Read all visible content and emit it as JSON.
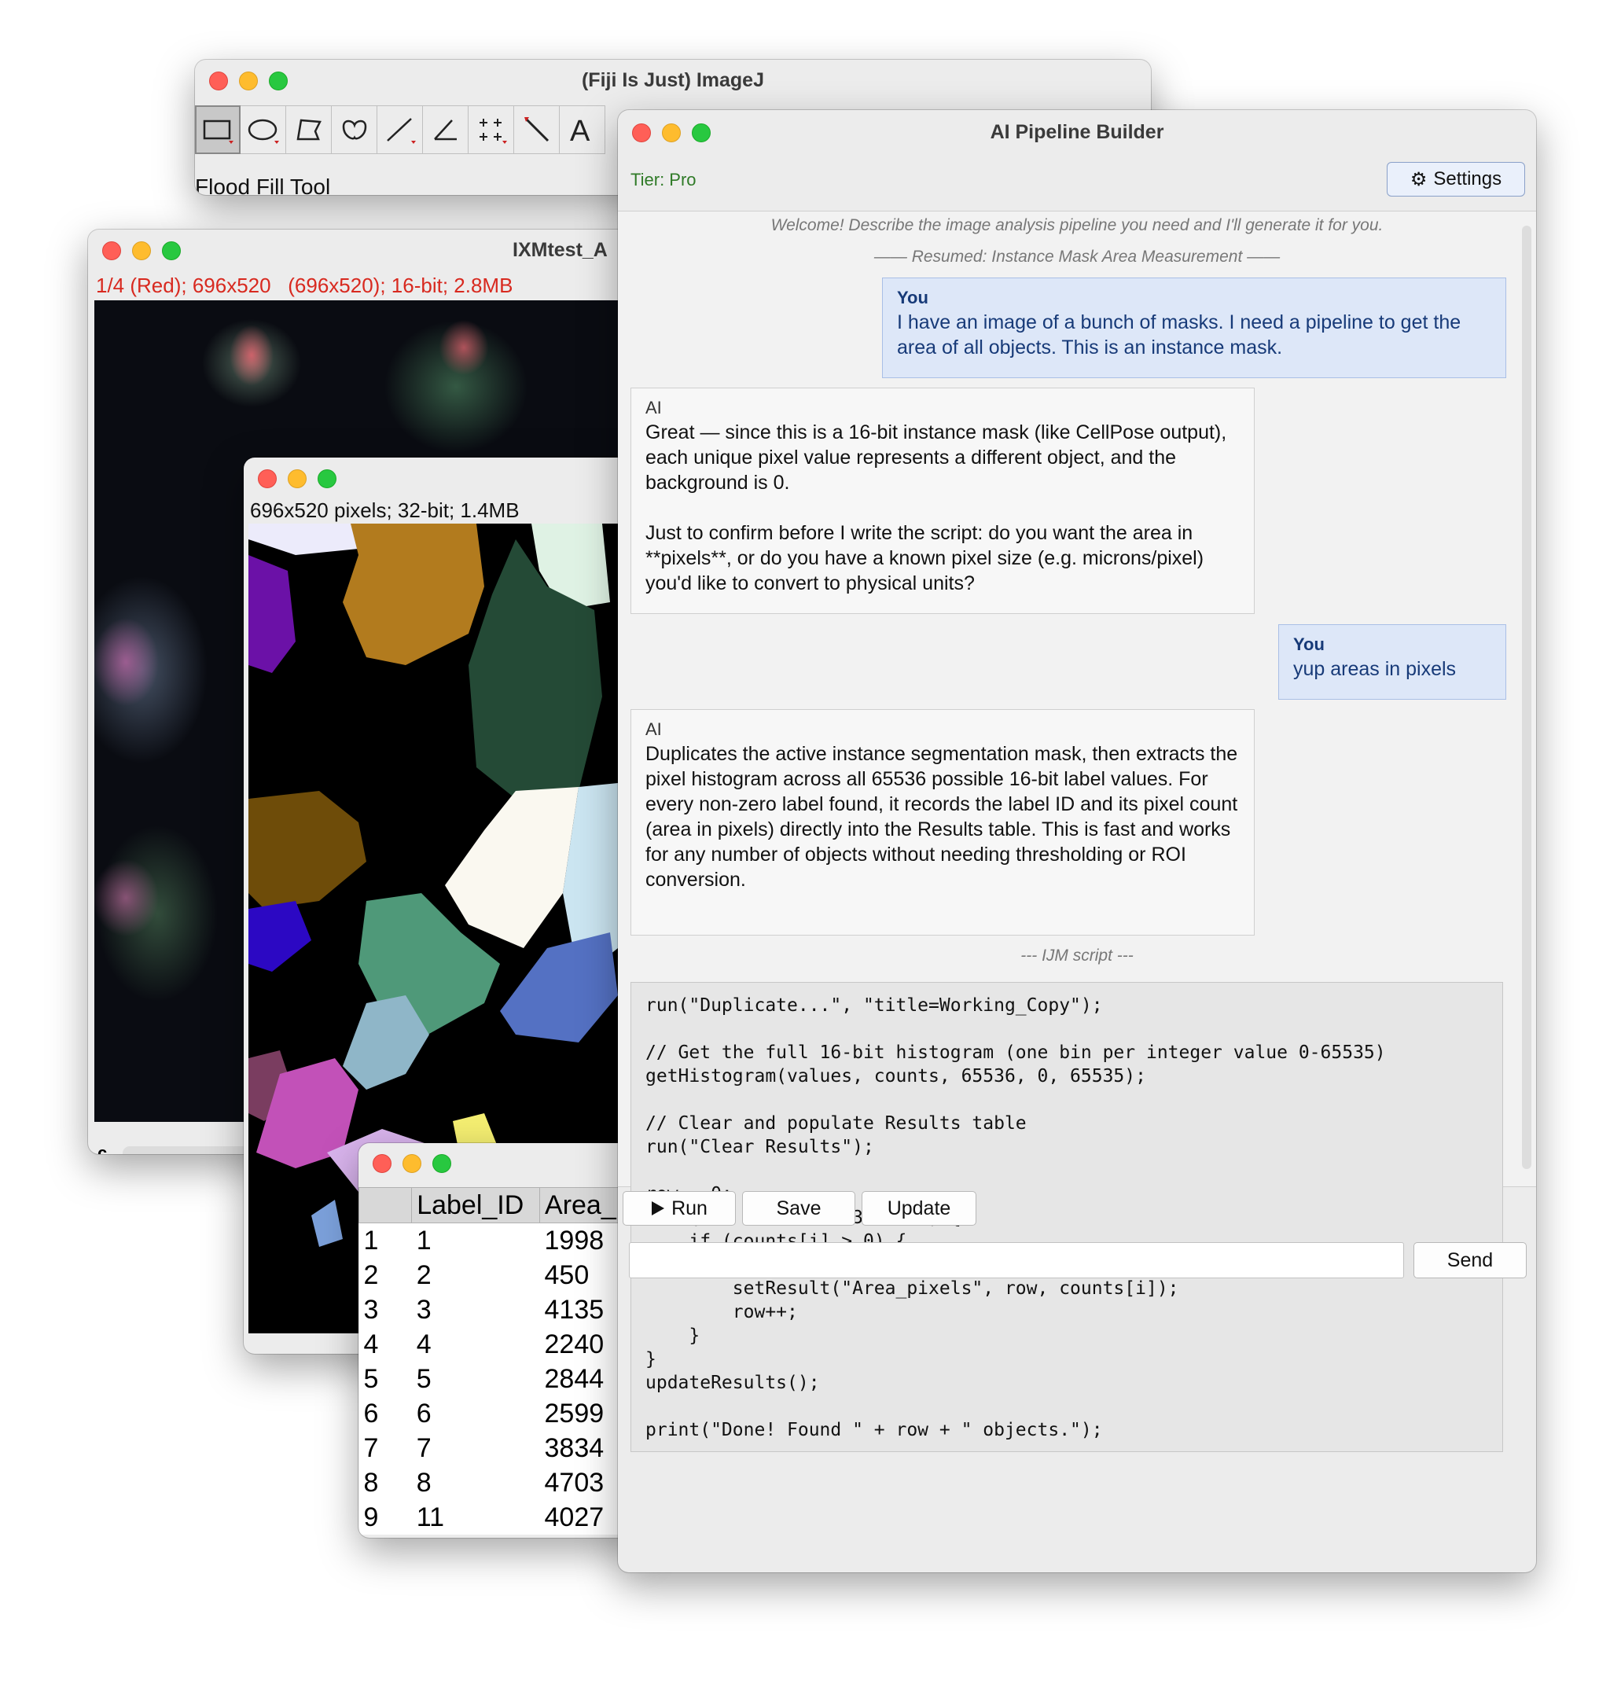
{
  "imagej": {
    "title": "(Fiji Is Just) ImageJ",
    "status": "Flood Fill Tool",
    "tools": [
      "rectangle-icon",
      "oval-icon",
      "polygon-icon",
      "freehand-icon",
      "line-icon",
      "angle-icon",
      "multipoint-icon",
      "wand-icon",
      "text-icon"
    ]
  },
  "ixm": {
    "title": "IXMtest_A",
    "info": "1/4 (Red); 696x520   (696x520); 16-bit; 2.8MB",
    "channel_label": "c"
  },
  "mask_window": {
    "info": "696x520 pixels; 32-bit; 1.4MB"
  },
  "results": {
    "columns": [
      "",
      "Label_ID",
      "Area_"
    ],
    "rows": [
      [
        "1",
        "1",
        "1998"
      ],
      [
        "2",
        "2",
        "450"
      ],
      [
        "3",
        "3",
        "4135"
      ],
      [
        "4",
        "4",
        "2240"
      ],
      [
        "5",
        "5",
        "2844"
      ],
      [
        "6",
        "6",
        "2599"
      ],
      [
        "7",
        "7",
        "3834"
      ],
      [
        "8",
        "8",
        "4703"
      ],
      [
        "9",
        "11",
        "4027"
      ]
    ]
  },
  "ai": {
    "title": "AI Pipeline Builder",
    "tier": "Tier: Pro",
    "settings_label": "Settings",
    "welcome": "Welcome! Describe the image analysis pipeline you need and I'll generate it for you.",
    "resumed": "—— Resumed: Instance Mask Area Measurement ——",
    "messages": [
      {
        "who": "You",
        "text": "I have an image of a bunch of masks. I need a pipeline to get the area of all objects. This is an instance mask."
      },
      {
        "who": "AI",
        "text": "Great — since this is a 16-bit instance mask (like CellPose output), each unique pixel value represents a different object, and the background is 0.\n\nJust to confirm before I write the script: do you want the area in **pixels**, or do you have a known pixel size (e.g. microns/pixel) you'd like to convert to physical units?"
      },
      {
        "who": "You",
        "text": "yup areas in pixels"
      },
      {
        "who": "AI",
        "text": "Duplicates the active instance segmentation mask, then extracts the pixel histogram across all 65536 possible 16-bit label values. For every non-zero label found, it records the label ID and its pixel count (area in pixels) directly into the Results table. This is fast and works for any number of objects without needing thresholding or ROI conversion."
      }
    ],
    "script_label": "--- IJM script ---",
    "script": "run(\"Duplicate...\", \"title=Working_Copy\");\n\n// Get the full 16-bit histogram (one bin per integer value 0-65535)\ngetHistogram(values, counts, 65536, 0, 65535);\n\n// Clear and populate Results table\nrun(\"Clear Results\");\n\nrow = 0;\nfor (i = 1; i < 65536; i++) {\n    if (counts[i] > 0) {\n        setResult(\"Label_ID\", row, i);\n        setResult(\"Area_pixels\", row, counts[i]);\n        row++;\n    }\n}\nupdateResults();\n\nprint(\"Done! Found \" + row + \" objects.\");",
    "run_label": "Run",
    "save_label": "Save",
    "update_label": "Update",
    "input_value": "",
    "send_label": "Send"
  }
}
